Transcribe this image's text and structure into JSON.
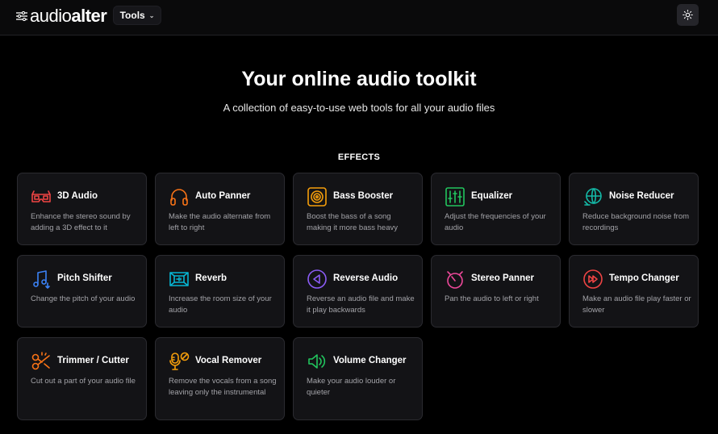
{
  "header": {
    "logo_part1": "audio",
    "logo_part2": "alter",
    "tools_label": "Tools"
  },
  "hero": {
    "title": "Your online audio toolkit",
    "subtitle": "A collection of easy-to-use web tools for all your audio files"
  },
  "section": {
    "title": "EFFECTS"
  },
  "tools": [
    {
      "title": "3D Audio",
      "desc": "Enhance the stereo sound by adding a 3D effect to it",
      "icon": "3d-glasses-icon",
      "color": "#ef4444"
    },
    {
      "title": "Auto Panner",
      "desc": "Make the audio alternate from left to right",
      "icon": "headphones-icon",
      "color": "#f97316"
    },
    {
      "title": "Bass Booster",
      "desc": "Boost the bass of a song making it more bass heavy",
      "icon": "speaker-icon",
      "color": "#f59e0b"
    },
    {
      "title": "Equalizer",
      "desc": "Adjust the frequencies of your audio",
      "icon": "equalizer-icon",
      "color": "#22c55e"
    },
    {
      "title": "Noise Reducer",
      "desc": "Reduce background noise from recordings",
      "icon": "globe-icon",
      "color": "#14b8a6"
    },
    {
      "title": "Pitch Shifter",
      "desc": "Change the pitch of your audio",
      "icon": "music-notes-icon",
      "color": "#3b82f6"
    },
    {
      "title": "Reverb",
      "desc": "Increase the room size of your audio",
      "icon": "reverb-room-icon",
      "color": "#06b6d4"
    },
    {
      "title": "Reverse Audio",
      "desc": "Reverse an audio file and make it play backwards",
      "icon": "reverse-play-icon",
      "color": "#8b5cf6"
    },
    {
      "title": "Stereo Panner",
      "desc": "Pan the audio to left or right",
      "icon": "pan-dial-icon",
      "color": "#ec4899"
    },
    {
      "title": "Tempo Changer",
      "desc": "Make an audio file play faster or slower",
      "icon": "fast-forward-icon",
      "color": "#ef4444"
    },
    {
      "title": "Trimmer / Cutter",
      "desc": "Cut out a part of your audio file",
      "icon": "scissors-icon",
      "color": "#f97316"
    },
    {
      "title": "Vocal Remover",
      "desc": "Remove the vocals from a song leaving only the instrumental",
      "icon": "mic-off-icon",
      "color": "#f59e0b"
    },
    {
      "title": "Volume Changer",
      "desc": "Make your audio louder or quieter",
      "icon": "volume-icon",
      "color": "#22c55e"
    }
  ]
}
